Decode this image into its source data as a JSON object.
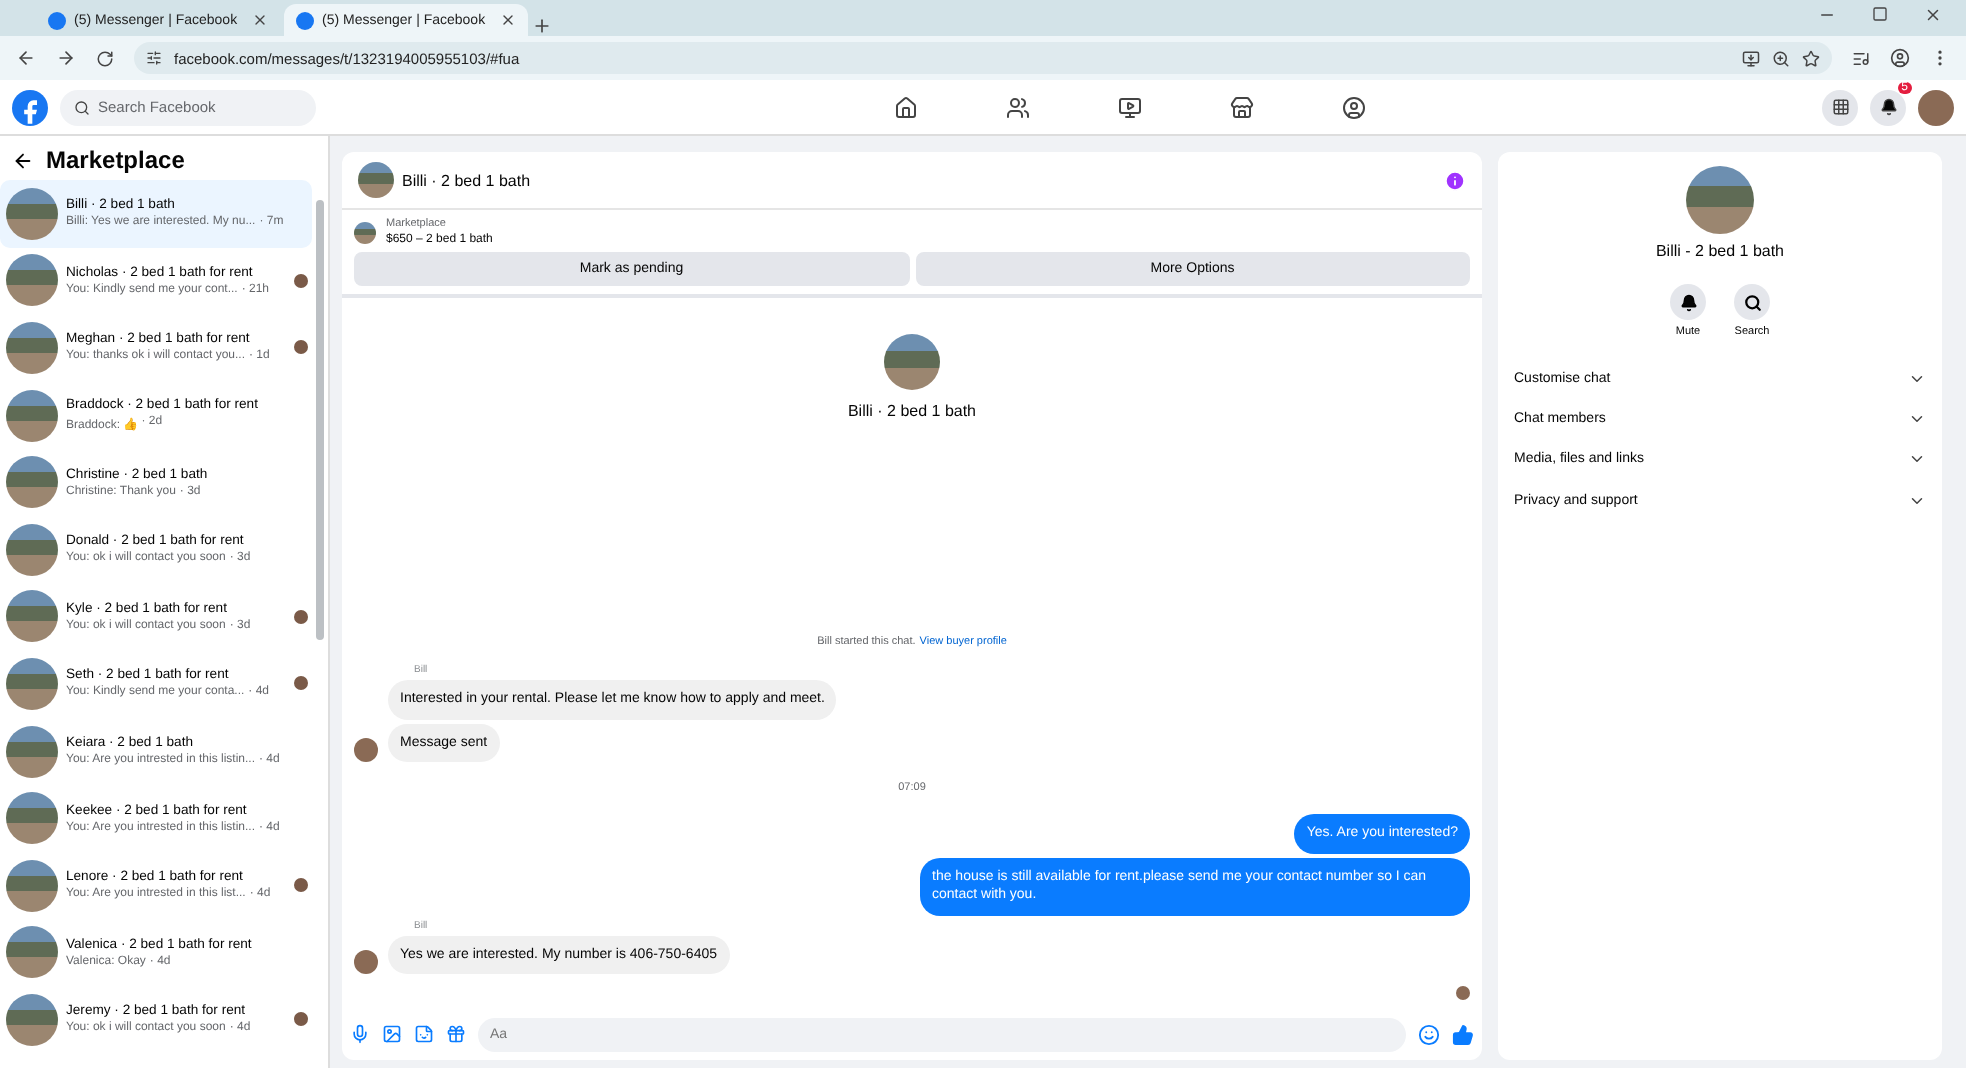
{
  "browser": {
    "tabs": [
      {
        "title": "(5) Messenger | Facebook",
        "selected": false
      },
      {
        "title": "(5) Messenger | Facebook",
        "selected": true
      }
    ],
    "url": "facebook.com/messages/t/1323194005955103/#fua"
  },
  "topbar": {
    "search_placeholder": "Search Facebook",
    "notification_count": "5"
  },
  "sidebar": {
    "title": "Marketplace",
    "conversations": [
      {
        "name": "Billi · 2 bed 1 bath",
        "preview": "Billi: Yes we are interested. My nu...",
        "time": "· 7m",
        "selected": true,
        "seen": false
      },
      {
        "name": "Nicholas · 2 bed 1 bath for rent",
        "preview": "You: Kindly send me your cont...",
        "time": "· 21h",
        "selected": false,
        "seen": true
      },
      {
        "name": "Meghan · 2 bed 1 bath for rent",
        "preview": "You: thanks ok i will contact you...",
        "time": "· 1d",
        "selected": false,
        "seen": true
      },
      {
        "name": "Braddock · 2 bed 1 bath for rent",
        "preview": "Braddock: 👍",
        "time": "· 2d",
        "selected": false,
        "seen": false
      },
      {
        "name": "Christine · 2 bed 1 bath",
        "preview": "Christine: Thank you",
        "time": "· 3d",
        "selected": false,
        "seen": false
      },
      {
        "name": "Donald · 2 bed 1 bath for rent",
        "preview": "You: ok i will contact you soon",
        "time": "· 3d",
        "selected": false,
        "seen": false
      },
      {
        "name": "Kyle · 2 bed 1 bath for rent",
        "preview": "You: ok i will contact you soon",
        "time": "· 3d",
        "selected": false,
        "seen": true
      },
      {
        "name": "Seth · 2 bed 1 bath for rent",
        "preview": "You: Kindly send me your conta...",
        "time": "· 4d",
        "selected": false,
        "seen": true
      },
      {
        "name": "Keiara · 2 bed 1 bath",
        "preview": "You: Are you intrested in this listin...",
        "time": "· 4d",
        "selected": false,
        "seen": false
      },
      {
        "name": "Keekee · 2 bed 1 bath for rent",
        "preview": "You: Are you intrested in this listin...",
        "time": "· 4d",
        "selected": false,
        "seen": false
      },
      {
        "name": "Lenore · 2 bed 1 bath for rent",
        "preview": "You: Are you intrested in this list...",
        "time": "· 4d",
        "selected": false,
        "seen": true
      },
      {
        "name": "Valenica · 2 bed 1 bath for rent",
        "preview": "Valenica: Okay",
        "time": "· 4d",
        "selected": false,
        "seen": false
      },
      {
        "name": "Jeremy · 2 bed 1 bath for rent",
        "preview": "You: ok i will contact you soon",
        "time": "· 4d",
        "selected": false,
        "seen": true
      }
    ]
  },
  "chat": {
    "title": "Billi · 2 bed 1 bath",
    "listing": {
      "label": "Marketplace",
      "price": "$650 – 2 bed 1 bath"
    },
    "buttons": [
      "Mark as pending",
      "More Options"
    ],
    "intro_name": "Billi · 2 bed 1 bath",
    "system_text": "Bill started this chat.",
    "system_link": "View buyer profile",
    "messages": [
      {
        "kind": "sender",
        "text": "Bill"
      },
      {
        "kind": "incoming",
        "text": "Interested in your rental.  Please let me know how to apply and meet.",
        "avatar": false
      },
      {
        "kind": "incoming",
        "text": "Message sent",
        "avatar": true
      },
      {
        "kind": "time",
        "text": "07:09"
      },
      {
        "kind": "outgoing",
        "text": "Yes. Are you interested?"
      },
      {
        "kind": "outgoing",
        "text": "the house is still available for rent.please send me your contact number so I can contact with you."
      },
      {
        "kind": "sender",
        "text": "Bill"
      },
      {
        "kind": "incoming",
        "text": "Yes we are interested.  My number is 406-750-6405",
        "avatar": true
      }
    ],
    "seen": true,
    "composer_placeholder": "Aa"
  },
  "details": {
    "name": "Billi - 2 bed 1 bath",
    "actions": [
      {
        "kind": "mute",
        "label": "Mute"
      },
      {
        "kind": "search",
        "label": "Search"
      }
    ],
    "sections": [
      "Customise chat",
      "Chat members",
      "Media, files and links",
      "Privacy and support"
    ]
  }
}
